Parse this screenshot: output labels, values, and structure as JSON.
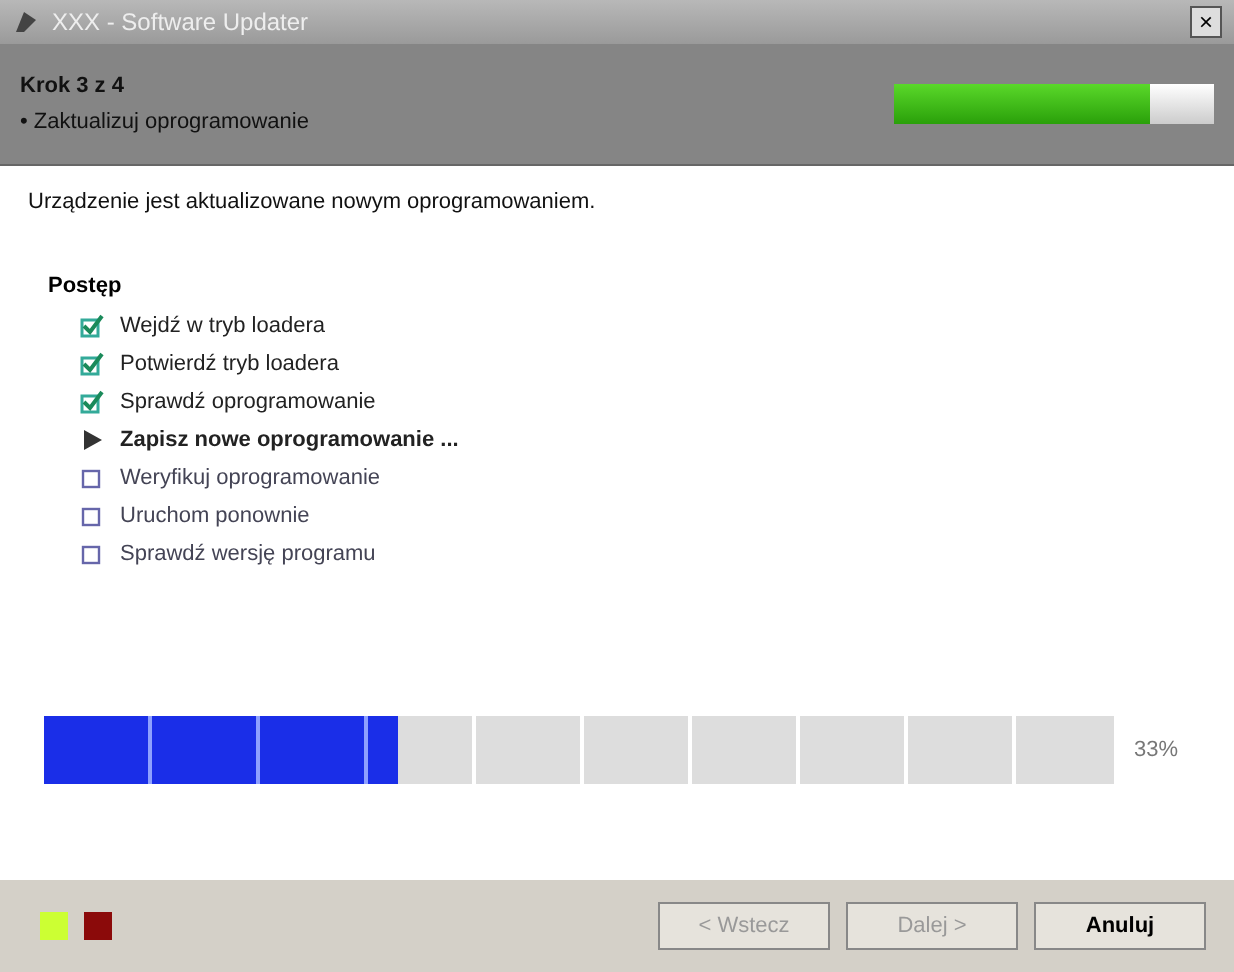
{
  "window": {
    "title": "XXX - Software Updater",
    "close": "×"
  },
  "header": {
    "step": "Krok 3 z 4",
    "subtitle": "• Zaktualizuj oprogramowanie",
    "level": 0.8
  },
  "intro": "Urządzenie jest aktualizowane nowym oprogramowaniem.",
  "progress_section": {
    "title": "Postęp",
    "steps": [
      {
        "kind": "done",
        "label": "Wejdź w tryb loadera"
      },
      {
        "kind": "done",
        "label": "Potwierdź tryb loadera"
      },
      {
        "kind": "done",
        "label": "Sprawdź oprogramowanie"
      },
      {
        "kind": "current",
        "label": "Zapisz nowe oprogramowanie ..."
      },
      {
        "kind": "pending",
        "label": "Weryfikuj oprogramowanie"
      },
      {
        "kind": "pending",
        "label": "Uruchom ponownie"
      },
      {
        "kind": "pending",
        "label": "Sprawdź wersję programu"
      }
    ]
  },
  "progress": {
    "level": 0.33,
    "reading": "33%"
  },
  "indicators": [
    {
      "color": "#ccff33"
    },
    {
      "color": "#8b0a0a"
    }
  ],
  "buttons": [
    {
      "label": "< Wstecz",
      "disabled": true
    },
    {
      "label": "Dalej >",
      "disabled": true
    },
    {
      "label": "Anuluj",
      "disabled": false
    }
  ]
}
